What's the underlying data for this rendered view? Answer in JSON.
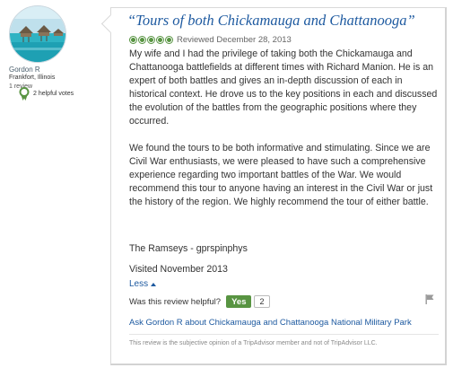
{
  "reviewer": {
    "name": "Gordon R",
    "location": "Frankfort, Illinois",
    "review_count": "1 review",
    "helpful_votes": "2 helpful votes",
    "avatar_icon": "beach-bungalow-avatar",
    "badge_icon": "helpful-votes-badge-icon"
  },
  "review": {
    "title": "“Tours of both Chickamauga and Chattanooga”",
    "rating_bubbles": 5,
    "rating_max": 5,
    "reviewed_date": "Reviewed December 28, 2013",
    "paragraph1": "My wife and I had the privilege of taking both the Chickamauga and Chattanooga battlefields at different times with Richard Manion. He is an expert of both battles and gives an in-depth discussion of each in historical context. He drove us to the key positions in each and discussed the evolution of the battles from the geographic positions where they occurred.",
    "paragraph2": "We found the tours to be both informative and stimulating. Since we are Civil War enthusiasts, we were pleased to have such a comprehensive experience regarding two important battles of the War. We would recommend this tour to anyone having an interest in the Civil War or just the history of the region. We highly recommend the tour of either battle.",
    "signature": "The Ramseys - gprspinphys",
    "visited": "Visited November 2013",
    "less_label": "Less"
  },
  "feedback": {
    "question": "Was this review helpful?",
    "yes_label": "Yes",
    "helpful_count": "2",
    "flag_icon": "flag-icon"
  },
  "ask": {
    "link_text": "Ask Gordon R about Chickamauga and Chattanooga National Military Park"
  },
  "disclaimer": "This review is the subjective opinion of a TripAdvisor member and not of TripAdvisor LLC.",
  "colors": {
    "link_blue": "#1e5aa0",
    "rating_green": "#589442",
    "text": "#333333",
    "muted": "#888888"
  }
}
